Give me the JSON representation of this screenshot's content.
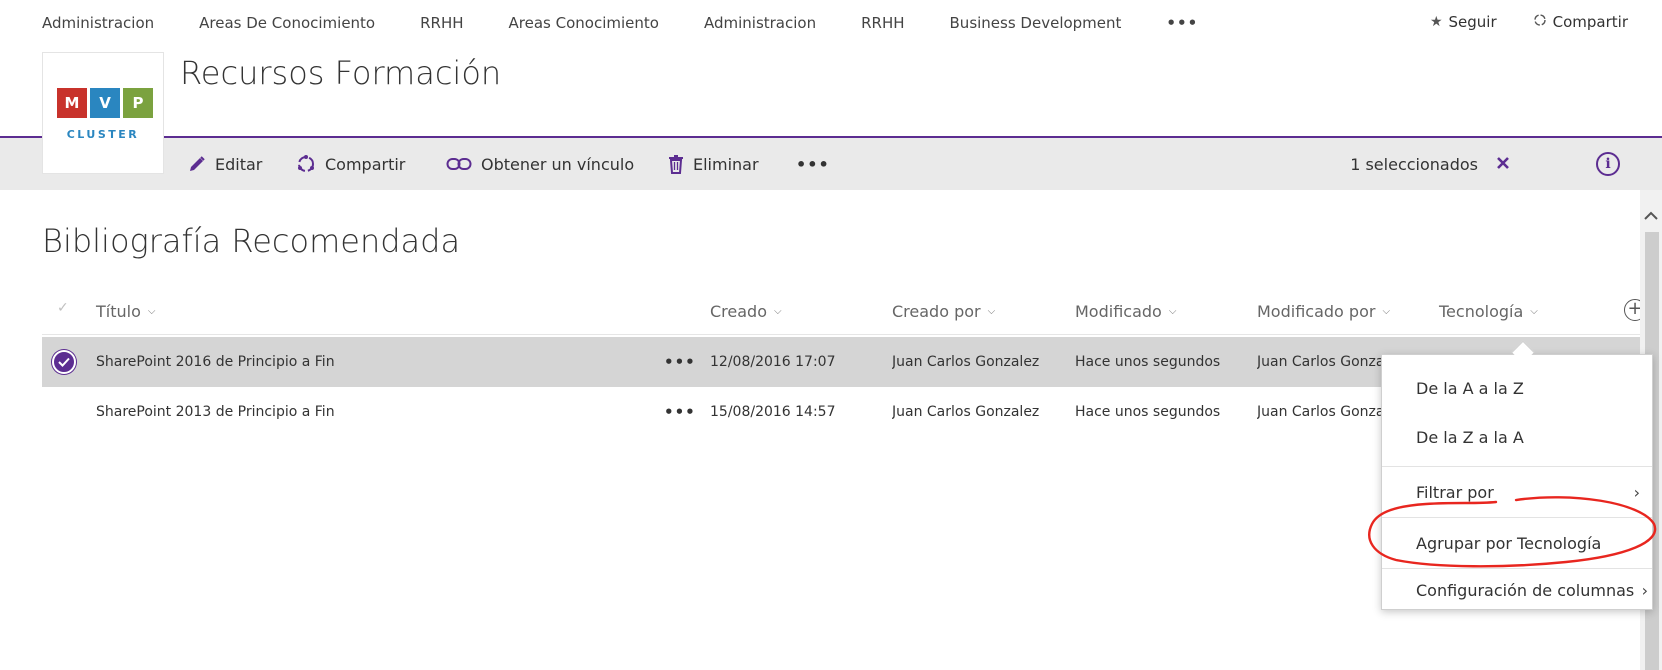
{
  "top_nav": {
    "items": [
      "Administracion",
      "Areas De Conocimiento",
      "RRHH",
      "Areas Conocimiento",
      "Administracion",
      "RRHH",
      "Business Development"
    ],
    "more": "•••",
    "follow_label": "Seguir",
    "share_label": "Compartir"
  },
  "header": {
    "logo_letters": [
      "M",
      "V",
      "P"
    ],
    "logo_colors": [
      "#c8322b",
      "#2a86c0",
      "#7ba23f"
    ],
    "logo_text": "CLUSTER",
    "site_title": "Recursos Formación",
    "accent_color": "#5c2d91"
  },
  "command_bar": {
    "edit_label": "Editar",
    "share_label": "Compartir",
    "link_label": "Obtener un vínculo",
    "delete_label": "Eliminar",
    "more": "•••",
    "selected_count": "1 seleccionados",
    "info_icon": "i"
  },
  "list": {
    "title": "Bibliografía Recomendada",
    "columns": [
      "Título",
      "Creado",
      "Creado por",
      "Modificado",
      "Modificado por",
      "Tecnología"
    ],
    "rows": [
      {
        "title": "SharePoint 2016 de Principio a Fin",
        "created": "12/08/2016 17:07",
        "created_by": "Juan Carlos Gonzalez",
        "modified": "Hace unos segundos",
        "modified_by": "Juan Carlos Gonzalez",
        "selected": true
      },
      {
        "title": "SharePoint 2013 de Principio a Fin",
        "created": "15/08/2016 14:57",
        "created_by": "Juan Carlos Gonzalez",
        "modified": "Hace unos segundos",
        "modified_by": "Juan Carlos Gonzalez",
        "selected": false
      }
    ],
    "row_more": "•••"
  },
  "column_menu": {
    "items": [
      "De la A a la Z",
      "De la Z a la A",
      "Filtrar por",
      "Agrupar por Tecnología",
      "Configuración de columnas"
    ],
    "submenu_chevron": "›"
  }
}
